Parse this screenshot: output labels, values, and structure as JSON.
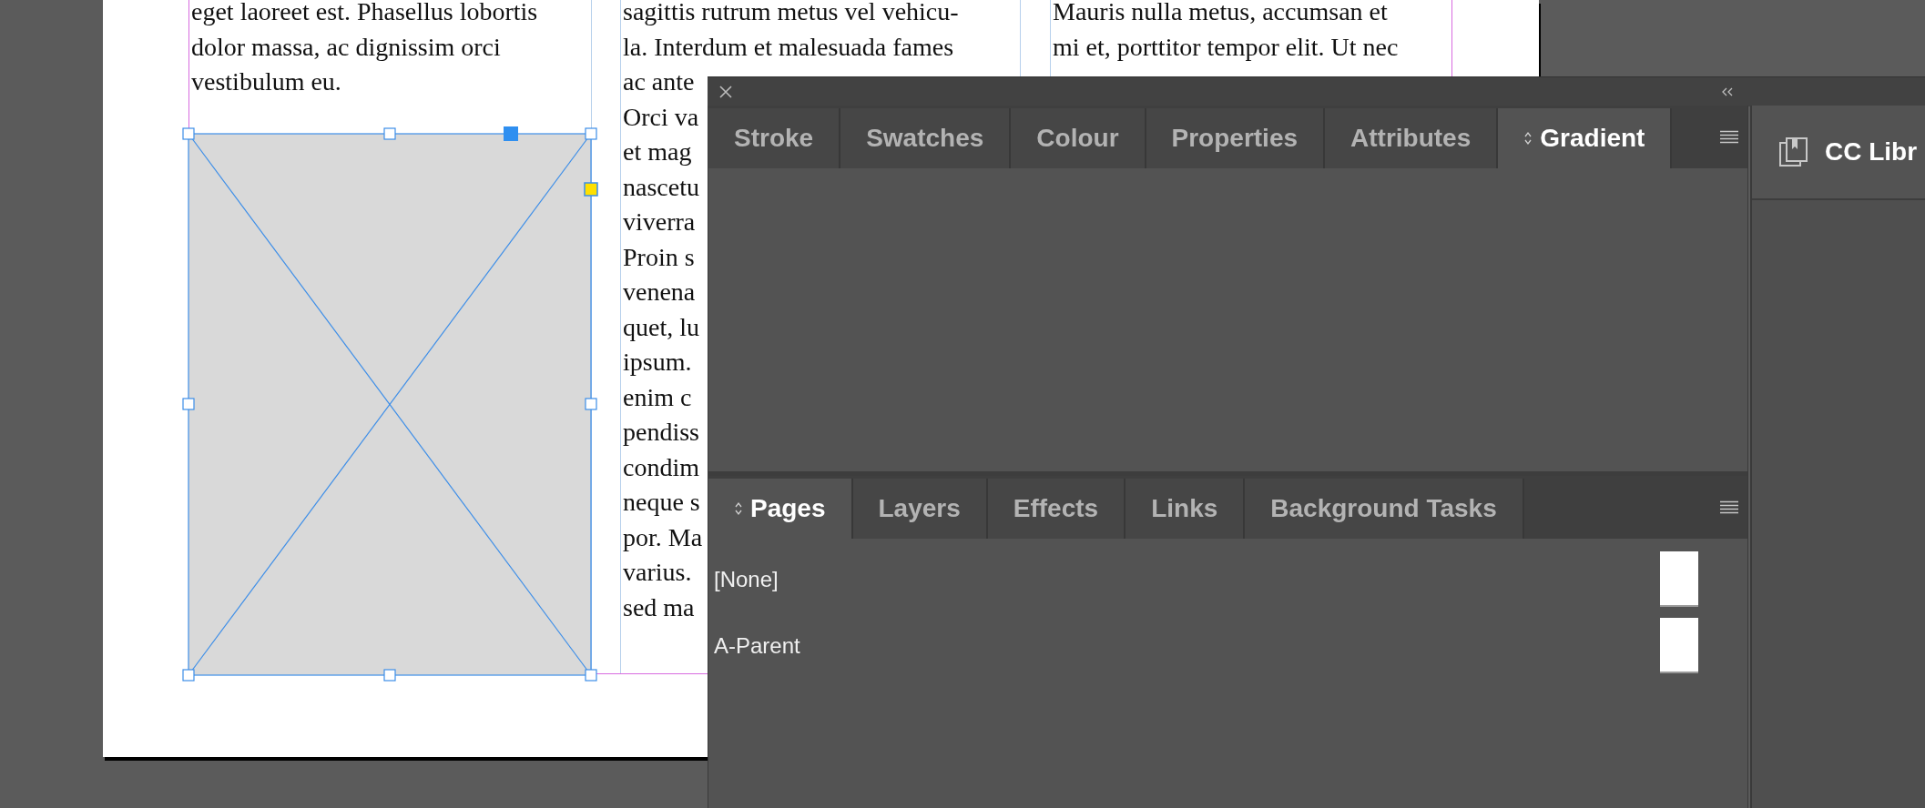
{
  "document": {
    "columns": [
      {
        "lines": [
          "eget laoreet est. Phasellus lobortis",
          "dolor massa, ac dignissim orci",
          "vestibulum eu."
        ]
      },
      {
        "lines": [
          "sagittis rutrum metus vel vehicu-",
          "la. Interdum et malesuada fames",
          "ac ante",
          "Orci va",
          "et mag",
          "nascetu",
          "viverra",
          "Proin s",
          "venena",
          "quet, lu",
          "ipsum.",
          "enim c",
          "pendiss",
          "condim",
          "neque s",
          "por. Ma",
          "varius.",
          "sed ma"
        ]
      },
      {
        "lines": [
          "Mauris nulla metus, accumsan et",
          "mi et, porttitor tempor elit. Ut nec"
        ]
      }
    ]
  },
  "panel": {
    "tab_groups": [
      {
        "tabs": [
          {
            "label": "Stroke",
            "selected": false
          },
          {
            "label": "Swatches",
            "selected": false
          },
          {
            "label": "Colour",
            "selected": false
          },
          {
            "label": "Properties",
            "selected": false
          },
          {
            "label": "Attributes",
            "selected": false
          },
          {
            "label": "Gradient",
            "selected": true
          }
        ]
      },
      {
        "tabs": [
          {
            "label": "Pages",
            "selected": true
          },
          {
            "label": "Layers",
            "selected": false
          },
          {
            "label": "Effects",
            "selected": false
          },
          {
            "label": "Links",
            "selected": false
          },
          {
            "label": "Background Tasks",
            "selected": false
          }
        ],
        "items": [
          {
            "label": "[None]"
          },
          {
            "label": "A-Parent"
          }
        ]
      }
    ]
  },
  "dock": {
    "label": "CC Libr"
  }
}
